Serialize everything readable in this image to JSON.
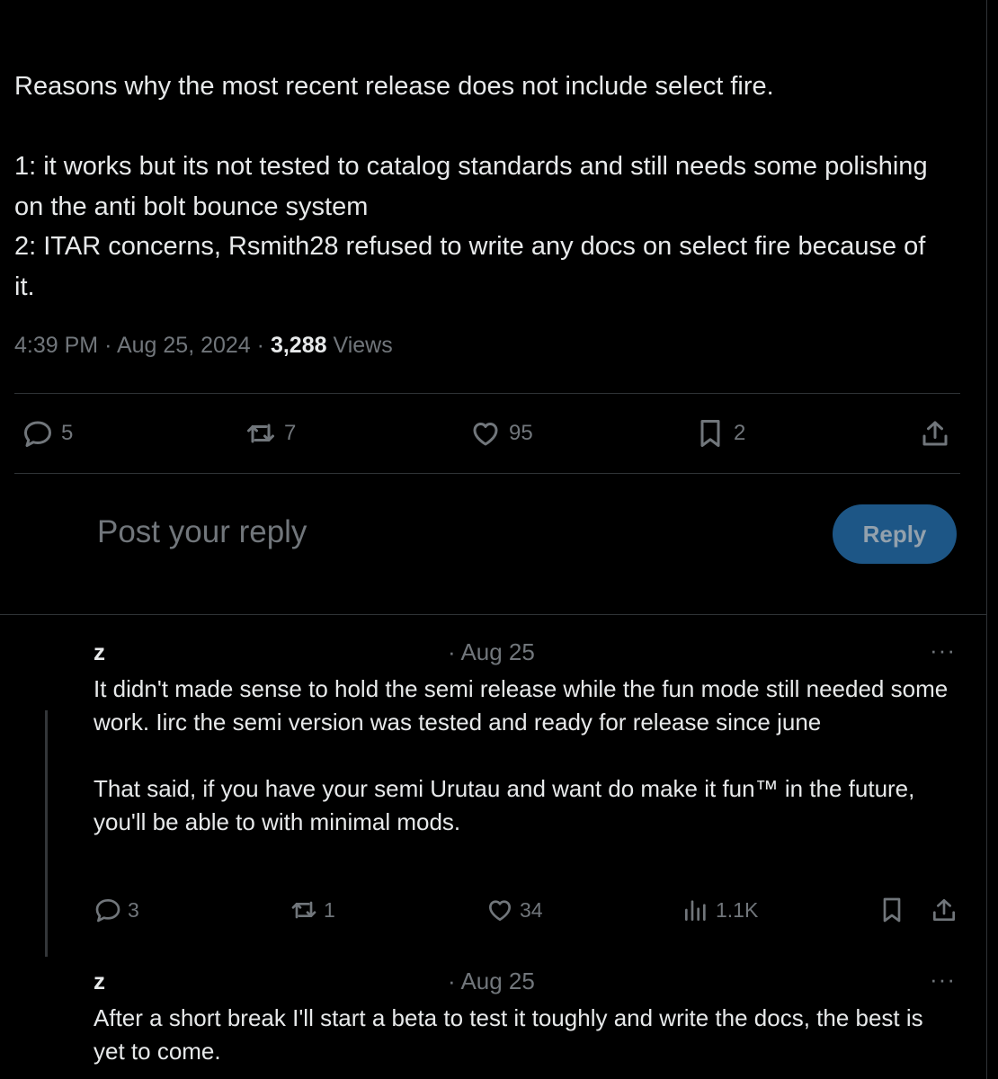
{
  "post": {
    "text": "Reasons why the most recent release does not include select fire.\n\n1: it works but its not tested to catalog standards and still needs some polishing on the anti bolt bounce system\n2: ITAR concerns, Rsmith28 refused to write any docs on select fire because of it.",
    "time": "4:39 PM",
    "date": "Aug 25, 2024",
    "separator": "·",
    "views_count": "3,288",
    "views_label": "Views",
    "actions": {
      "replies": "5",
      "reposts": "7",
      "likes": "95",
      "bookmarks": "2"
    }
  },
  "composer": {
    "placeholder": "Post your reply",
    "button_label": "Reply"
  },
  "replies": [
    {
      "name": "z",
      "date": "· Aug 25",
      "more": "···",
      "text": "It didn't made sense to hold the semi release while the fun mode still needed some work. Iirc the semi version was tested and ready for release since june\n\nThat said, if you have your semi Urutau and want do make it fun™ in the future, you'll be able to with minimal mods.",
      "actions": {
        "replies": "3",
        "reposts": "1",
        "likes": "34",
        "views": "1.1K"
      }
    },
    {
      "name": "z",
      "date": "· Aug 25",
      "more": "···",
      "text": "After a short break I'll start a beta to test it toughly and write the docs, the best is yet to come."
    }
  ],
  "colors": {
    "background": "#000000",
    "text": "#e7e9ea",
    "muted": "#71767b",
    "reply_button": "#1d5686",
    "divider": "#2f3336"
  }
}
